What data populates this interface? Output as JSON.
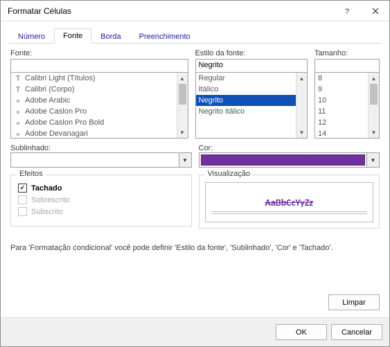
{
  "window": {
    "title": "Formatar Células"
  },
  "tabs": {
    "numero": "Número",
    "fonte": "Fonte",
    "borda": "Borda",
    "preenchimento": "Preenchimento"
  },
  "labels": {
    "fonte": "Fonte:",
    "estilo": "Estilo da fonte:",
    "tamanho": "Tamanho:",
    "sublinhado": "Sublinhado:",
    "cor": "Cor:",
    "efeitos": "Efeitos",
    "visualizacao": "Visualização"
  },
  "font_style_value": "Negrito",
  "fonts": [
    "Calibri Light (Títulos)",
    "Calibri (Corpo)",
    "Adobe Arabic",
    "Adobe Caslon Pro",
    "Adobe Caslon Pro Bold",
    "Adobe Devanagari"
  ],
  "styles": [
    "Regular",
    "Itálico",
    "Negrito",
    "Negrito itálico"
  ],
  "sizes": [
    "8",
    "9",
    "10",
    "11",
    "12",
    "14"
  ],
  "effects": {
    "tachado": "Tachado",
    "sobrescrito": "Sobrescrito",
    "subscrito": "Subscrito"
  },
  "preview_sample": "AaBbCcYyZz",
  "hint": "Para 'Formatação condicional' você pode definir 'Estilo da fonte', 'Sublinhado', 'Cor' e 'Tachado'.",
  "buttons": {
    "limpar": "Limpar",
    "ok": "OK",
    "cancelar": "Cancelar"
  },
  "colors": {
    "selected": "#7030a0"
  }
}
